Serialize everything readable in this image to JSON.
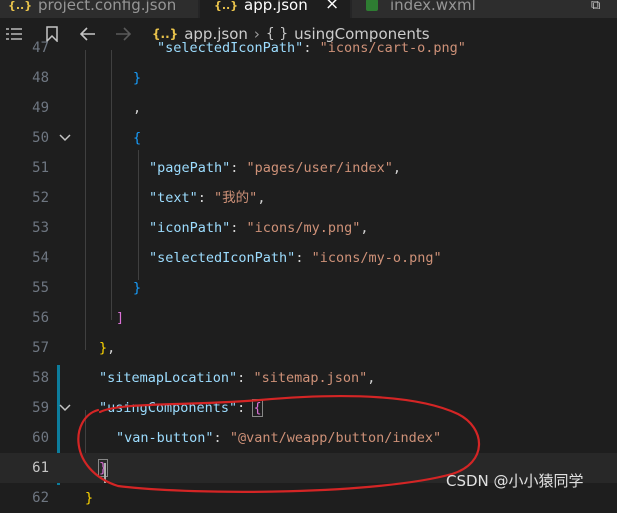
{
  "tabs": [
    {
      "icon": "{..}",
      "label": "project.config.json"
    },
    {
      "icon": "{..}",
      "label": "app.json",
      "close": "×"
    },
    {
      "label": "index.wxml"
    }
  ],
  "window": {
    "restore": "⧉"
  },
  "breadcrumb": {
    "file_icon": "{..}",
    "file": "app.json",
    "sep": "›",
    "node_icon": "{ }",
    "node": "usingComponents"
  },
  "lines": {
    "l47": {
      "num": "47",
      "key": "\"selectedIconPath\"",
      "colon": ": ",
      "value": "\"icons/cart-o.png\""
    },
    "l48": {
      "num": "48",
      "brace": "}"
    },
    "l49": {
      "num": "49",
      "text": ","
    },
    "l50": {
      "num": "50",
      "brace": "{"
    },
    "l51": {
      "num": "51",
      "key": "\"pagePath\"",
      "colon": ": ",
      "value": "\"pages/user/index\"",
      "comma": ","
    },
    "l52": {
      "num": "52",
      "key": "\"text\"",
      "colon": ": ",
      "value": "\"我的\"",
      "comma": ","
    },
    "l53": {
      "num": "53",
      "key": "\"iconPath\"",
      "colon": ": ",
      "value": "\"icons/my.png\"",
      "comma": ","
    },
    "l54": {
      "num": "54",
      "key": "\"selectedIconPath\"",
      "colon": ": ",
      "value": "\"icons/my-o.png\""
    },
    "l55": {
      "num": "55",
      "brace": "}"
    },
    "l56": {
      "num": "56",
      "brace": "]"
    },
    "l57": {
      "num": "57",
      "brace": "}",
      "comma": ","
    },
    "l58": {
      "num": "58",
      "key": "\"sitemapLocation\"",
      "colon": ": ",
      "value": "\"sitemap.json\"",
      "comma": ","
    },
    "l59": {
      "num": "59",
      "key": "\"usingComponents\"",
      "colon": ": ",
      "brace": "{"
    },
    "l60": {
      "num": "60",
      "key": "\"van-button\"",
      "colon": ": ",
      "value": "\"@vant/weapp/button/index\""
    },
    "l61": {
      "num": "61",
      "brace": "}"
    },
    "l62": {
      "num": "62",
      "brace": "}"
    }
  },
  "watermark": "CSDN @小小猿同学",
  "colors": {
    "annotation": "#d42525",
    "modified_bar": "#0c7d9d"
  }
}
